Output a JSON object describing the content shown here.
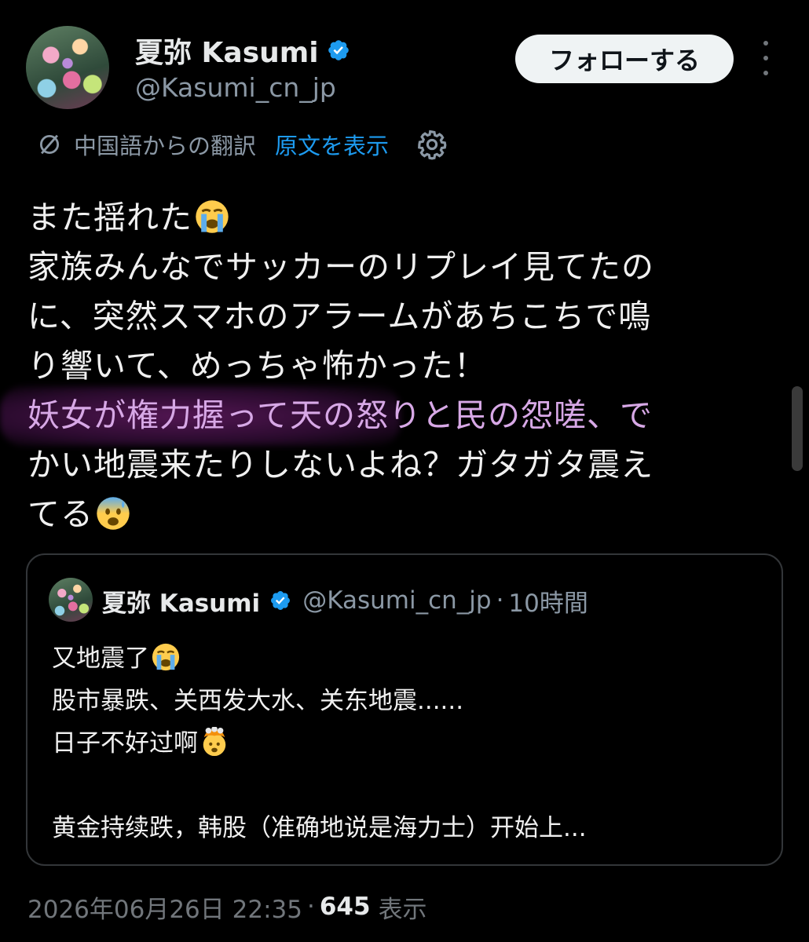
{
  "colors": {
    "background": "#000000",
    "text": "#e7e9ea",
    "secondary_text": "#8b98a5",
    "link": "#1d9bf0",
    "verified_badge": "#1d9bf0",
    "follow_button_bg": "#eff3f4",
    "highlight": "#8e2a8e"
  },
  "post": {
    "author": {
      "name": "夏弥 Kasumi",
      "handle": "@Kasumi_cn_jp",
      "verified_icon": "verified-badge-icon",
      "avatar": "flower-avatar"
    },
    "follow_label": "フォローする",
    "more_icon": "more-vertical-icon",
    "translation": {
      "icon": "translate-icon",
      "label": "中国語からの翻訳",
      "show_original": "原文を表示",
      "settings_icon": "gear-icon"
    },
    "body_lines": [
      "また揺れた",
      "家族みんなでサッカーのリプレイ見てたの",
      "に、突然スマホのアラームがあちこちで鳴",
      "り響いて、めっちゃ怖かった！",
      "妖女が権力握って天の怒りと民の怨嗟、で",
      "かい地震来たりしないよね？ガタガタ震え",
      "てる"
    ],
    "body_emojis": {
      "line1": "loudly-crying-face-emoji",
      "line7": "anxious-face-with-sweat-emoji"
    },
    "quote": {
      "name": "夏弥 Kasumi",
      "handle": "@Kasumi_cn_jp",
      "separator": "·",
      "time": "10時間",
      "lines": [
        "又地震了",
        "股市暴跌、关西发大水、关东地震......",
        "日子不好过啊",
        "",
        "黄金持续跌，韩股（准确地说是海力士）开始上..."
      ],
      "emojis": {
        "line1": "loudly-crying-face-emoji",
        "line3": "exploding-head-emoji"
      }
    },
    "timestamp": "2026年06月26日 22:35",
    "meta_separator": "·",
    "views_count": "645",
    "views_label": "表示"
  }
}
